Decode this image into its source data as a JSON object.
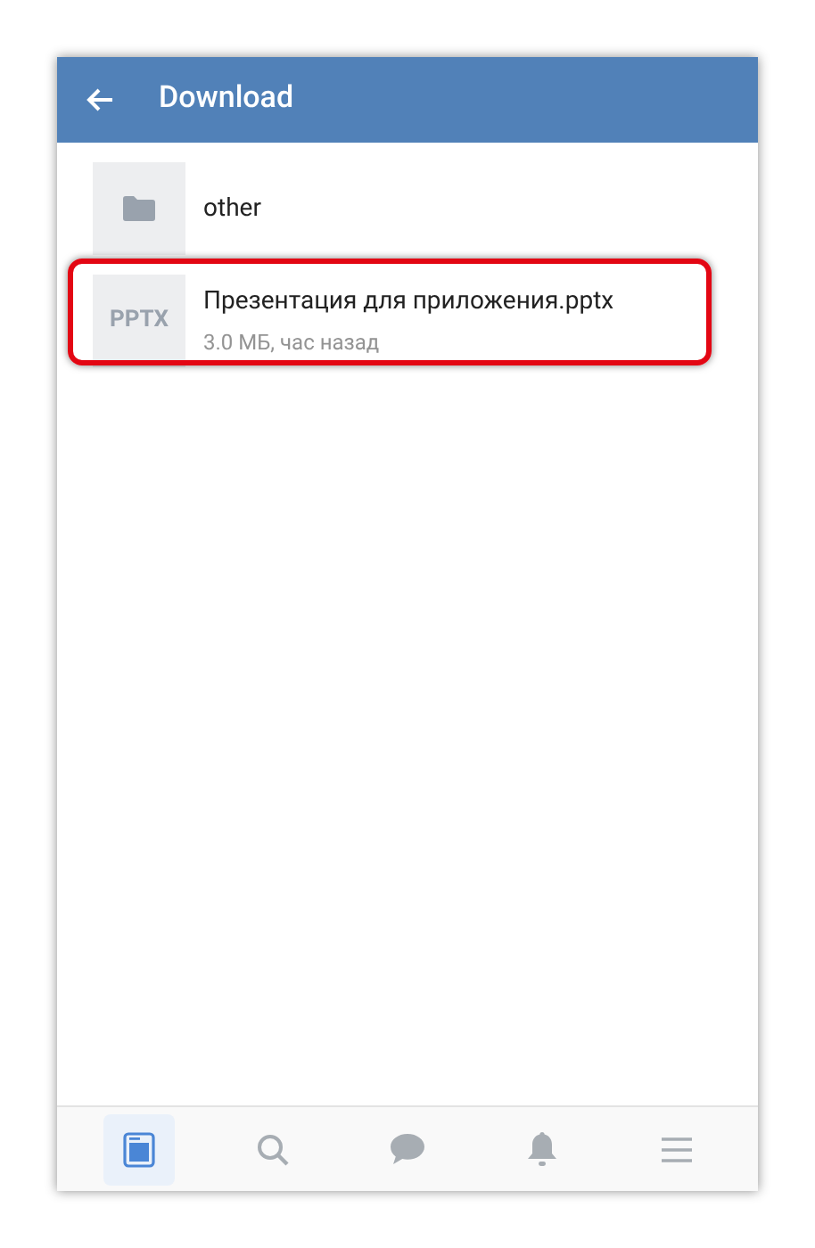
{
  "header": {
    "title": "Download"
  },
  "files": [
    {
      "kind": "folder",
      "name": "other",
      "highlighted": false
    },
    {
      "kind": "file",
      "thumb": "PPTX",
      "name": "Презентация для приложения.pptx",
      "meta": "3.0 МБ, час назад",
      "highlighted": true
    }
  ],
  "nav": [
    {
      "kind": "news",
      "selected": true
    },
    {
      "kind": "search",
      "selected": false
    },
    {
      "kind": "messages",
      "selected": false
    },
    {
      "kind": "notifications",
      "selected": false
    },
    {
      "kind": "menu",
      "selected": false
    }
  ]
}
